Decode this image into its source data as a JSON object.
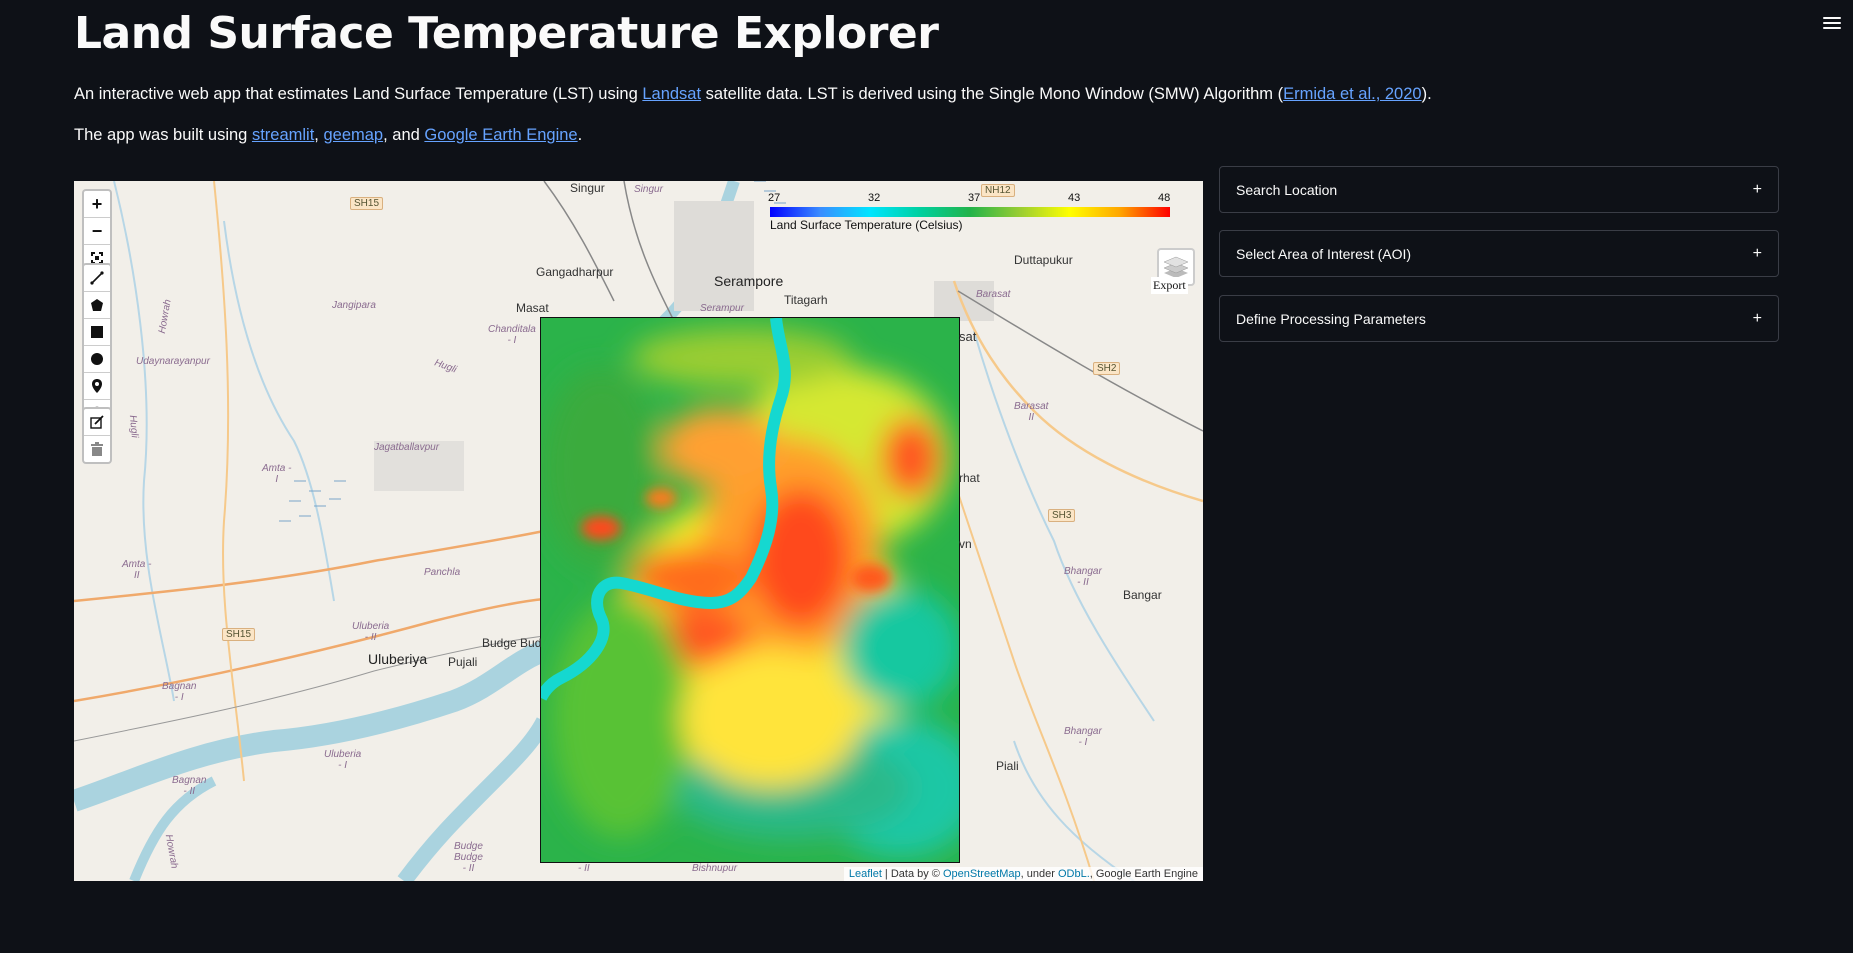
{
  "header": {
    "title": "Land Surface Temperature Explorer",
    "desc1_prefix": "An interactive web app that estimates Land Surface Temperature (LST) using ",
    "desc1_link1": "Landsat",
    "desc1_middle": " satellite data. LST is derived using the Single Mono Window (SMW) Algorithm (",
    "desc1_link2": "Ermida et al., 2020",
    "desc1_suffix": ").",
    "desc2_prefix": "The app was built using ",
    "desc2_link1": "streamlit",
    "desc2_sep1": ", ",
    "desc2_link2": "geemap",
    "desc2_sep2": ", and ",
    "desc2_link3": "Google Earth Engine",
    "desc2_suffix": "."
  },
  "map": {
    "zoom_in": "+",
    "zoom_out": "−",
    "export_label": "Export",
    "colorbar": {
      "ticks": [
        "27",
        "32",
        "37",
        "43",
        "48"
      ],
      "label": "Land Surface Temperature (Celsius)",
      "colors": [
        "#0000ff",
        "#3a8cff",
        "#00e5ff",
        "#00d0a0",
        "#22b34a",
        "#9acd32",
        "#ffff00",
        "#ffa500",
        "#ff0000"
      ]
    },
    "attribution": {
      "leaflet": "Leaflet",
      "sep1": " | Data by © ",
      "osm": "OpenStreetMap",
      "sep2": ", under ",
      "odbl": "ODbL.",
      "sep3": ", Google Earth Engine"
    },
    "places": {
      "singur": "Singur",
      "singur2": "Singur",
      "gangadharpur": "Gangadharpur",
      "serampore": "Serampore",
      "titagarh": "Titagarh",
      "masat": "Masat",
      "duttapukur": "Duttapukur",
      "uluberiya": "Uluberiya",
      "pujali": "Pujali",
      "budge_bud": "Budge Bud",
      "bangar": "Bangar",
      "piali": "Piali",
      "bishnupur": "Bishnupur",
      "sat": "sat",
      "rhat": "rhat",
      "vn": "vn"
    },
    "admin": {
      "jangipara": "Jangipara",
      "udaynarayanpur": "Udaynarayanpur",
      "howrah": "Howrah",
      "hugli": "Hugli",
      "chanditala": "Chanditala\n- I",
      "amta1": "Amta -\nI",
      "amta2": "Amta -\nII",
      "jagatballavpur": "Jagatballavpur",
      "panchla": "Panchla",
      "uluberia2": "Uluberia\n- II",
      "uluberia1": "Uluberia\n- I",
      "bagnan1": "Bagnan\n- I",
      "bagnan2": "Bagnan\n- II",
      "budge2": "Budge\nBudge\n- II",
      "barasat2": "Barasat\nII",
      "barasat": "Barasat",
      "bhangar2": "Bhangar\n- II",
      "bhangar1": "Bhangar\n- I",
      "serampur": "Serampur",
      "hugli2": "Hugli",
      "howrah2": "Howrah",
      "bishnupur2": "- II"
    },
    "shields": {
      "sh15a": "SH15",
      "sh15b": "SH15",
      "nh12": "NH12",
      "sh2": "SH2",
      "sh3": "SH3"
    }
  },
  "sidebar": {
    "panels": [
      {
        "label": "Search Location",
        "icon": "+"
      },
      {
        "label": "Select Area of Interest (AOI)",
        "icon": "+"
      },
      {
        "label": "Define Processing Parameters",
        "icon": "+"
      }
    ]
  }
}
